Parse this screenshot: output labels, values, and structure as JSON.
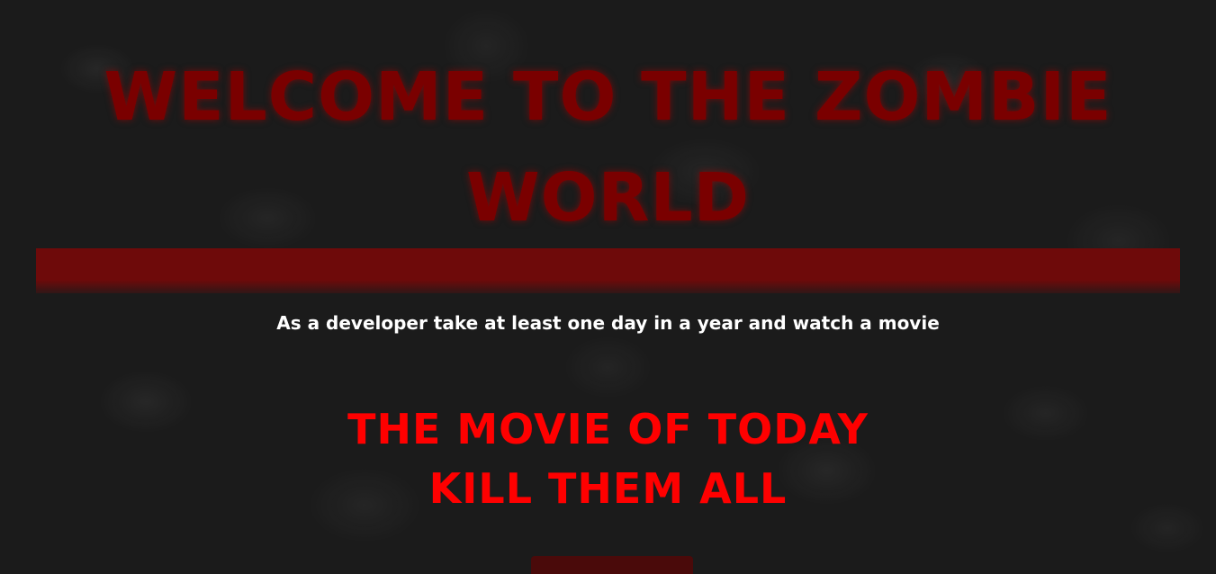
{
  "header": {
    "title": "WELCOME TO THE ZOMBIE WORLD"
  },
  "tagline": "As a developer take at least one day in a year and watch a movie",
  "movie": {
    "heading_line1": "THE MOVIE OF TODAY",
    "heading_line2": "KILL THEM ALL"
  },
  "colors": {
    "background": "#1b1b1b",
    "title": "#7a0000",
    "divider": "#6e0a0a",
    "tagline": "#ffffff",
    "movie_heading": "#ff0000",
    "button": "#4a0a0a"
  }
}
